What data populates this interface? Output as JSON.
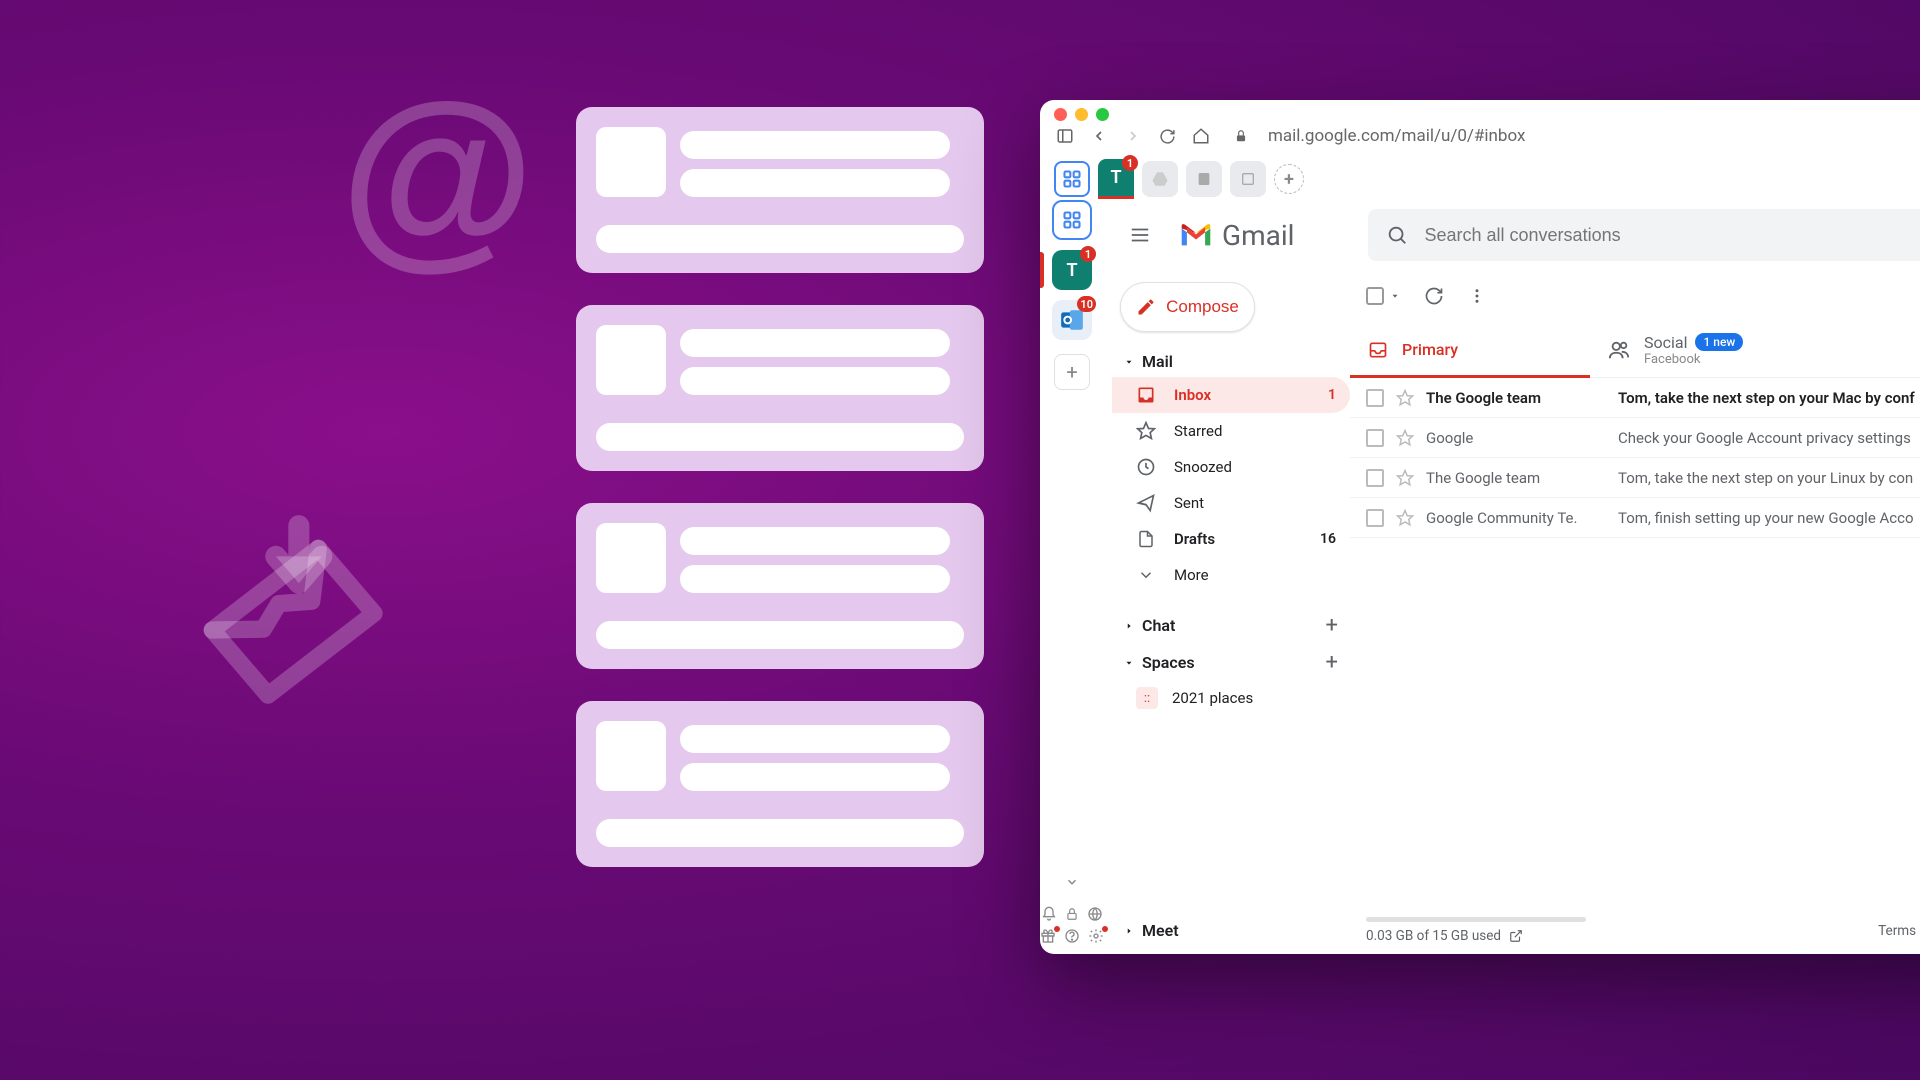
{
  "browser": {
    "url": "mail.google.com/mail/u/0/#inbox",
    "tabstrip": {
      "account_letter": "T",
      "account_badge": "1"
    }
  },
  "apprail": {
    "teal_letter": "T",
    "teal_badge": "1",
    "outlook_badge": "10"
  },
  "gmail": {
    "brand": "Gmail",
    "search_placeholder": "Search all conversations",
    "compose": "Compose",
    "sections": {
      "mail": "Mail",
      "chat": "Chat",
      "spaces": "Spaces",
      "meet": "Meet"
    },
    "folders": {
      "inbox": {
        "label": "Inbox",
        "count": "1"
      },
      "starred": "Starred",
      "snoozed": "Snoozed",
      "sent": "Sent",
      "drafts": {
        "label": "Drafts",
        "count": "16"
      },
      "more": "More"
    },
    "space_item": "2021 places",
    "tabs": {
      "primary": "Primary",
      "social": {
        "label": "Social",
        "badge": "1 new",
        "sub": "Facebook"
      }
    },
    "emails": [
      {
        "sender": "The Google team",
        "subject": "Tom, take the next step on your Mac by conf",
        "unread": true
      },
      {
        "sender": "Google",
        "subject": "Check your Google Account privacy settings",
        "unread": false
      },
      {
        "sender": "The Google team",
        "subject": "Tom, take the next step on your Linux by con",
        "unread": false
      },
      {
        "sender": "Google Community Te.",
        "subject": "Tom, finish setting up your new Google Acco",
        "unread": false
      }
    ],
    "footer": {
      "storage": "0.03 GB of 15 GB used",
      "links": "Terms · Privacy · Programme Polic"
    }
  }
}
